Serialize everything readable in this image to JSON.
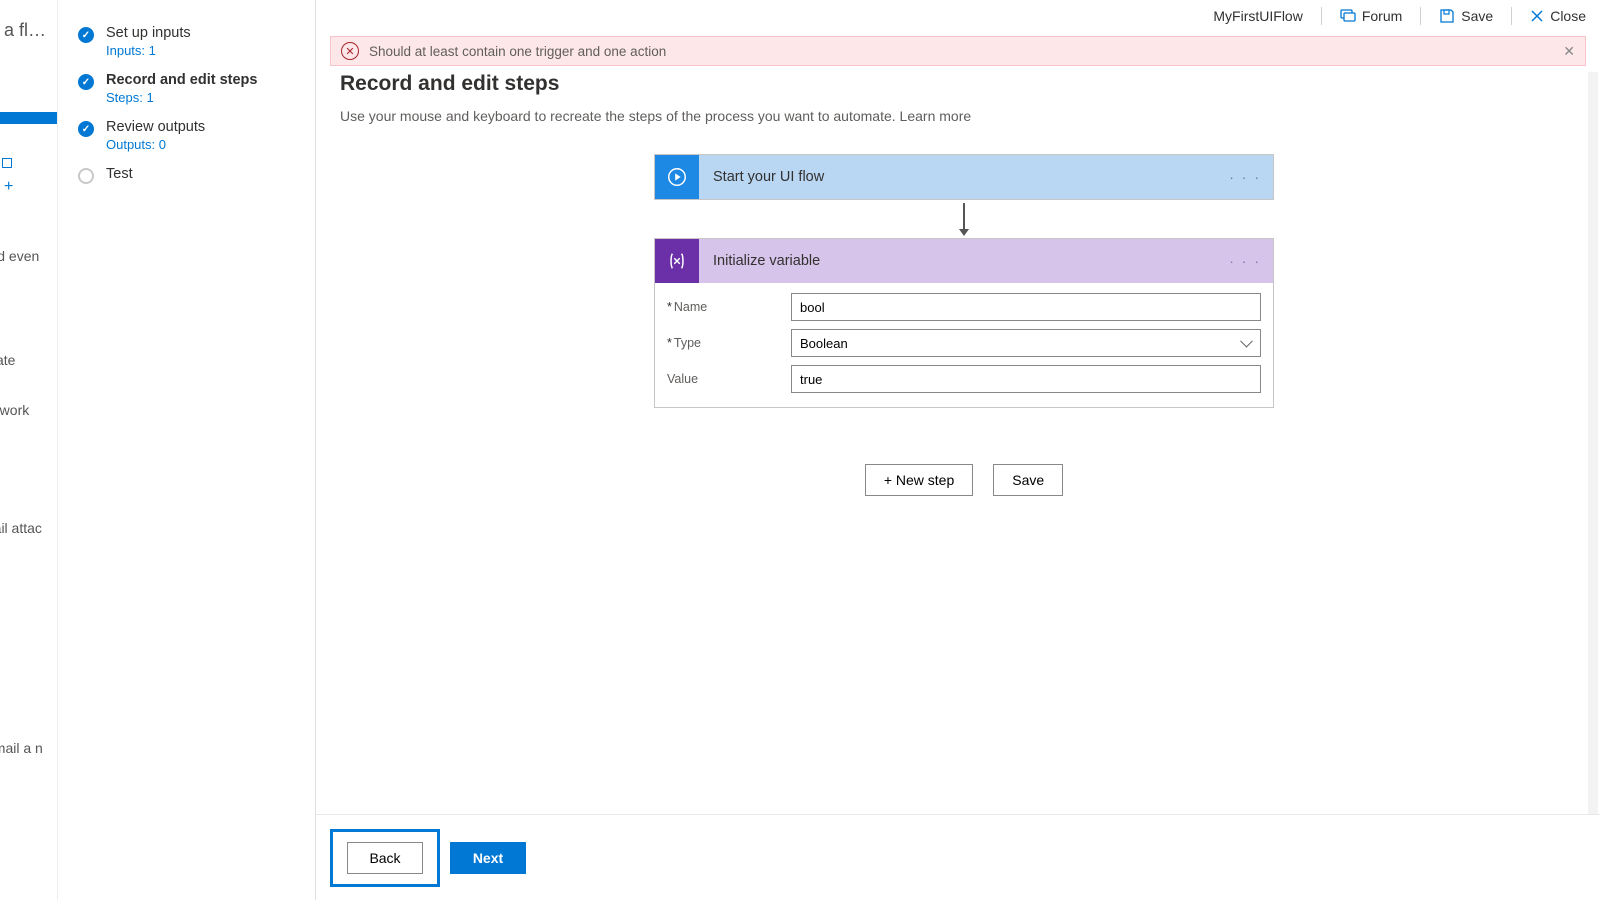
{
  "bgnav": {
    "title_peek": "ake a fl…",
    "item_automated": "nated even",
    "item_date": "ate",
    "item_work": "e work",
    "item_mail_attac": "mail attac",
    "item_mail_new": "email a n"
  },
  "sidebar": {
    "steps": [
      {
        "label": "Set up inputs",
        "sub": "Inputs: 1",
        "state": "done"
      },
      {
        "label": "Record and edit steps",
        "sub": "Steps: 1",
        "state": "current"
      },
      {
        "label": "Review outputs",
        "sub": "Outputs: 0",
        "state": "done"
      },
      {
        "label": "Test",
        "sub": "",
        "state": "pending"
      }
    ]
  },
  "header": {
    "flow_name": "MyFirstUIFlow",
    "forum": "Forum",
    "save": "Save",
    "close": "Close"
  },
  "alert": {
    "text": "Should at least contain one trigger and one action"
  },
  "page": {
    "title": "Record and edit steps",
    "subtitle": "Use your mouse and keyboard to recreate the steps of the process you want to automate.  ",
    "learn_more": "Learn more"
  },
  "flow": {
    "trigger": {
      "title": "Start your UI flow"
    },
    "action": {
      "title": "Initialize variable",
      "fields": {
        "name_label": "Name",
        "name_value": "bool",
        "type_label": "Type",
        "type_value": "Boolean",
        "value_label": "Value",
        "value_value": "true"
      }
    },
    "buttons": {
      "new_step": "+ New step",
      "save": "Save"
    }
  },
  "footer": {
    "back": "Back",
    "next": "Next"
  }
}
